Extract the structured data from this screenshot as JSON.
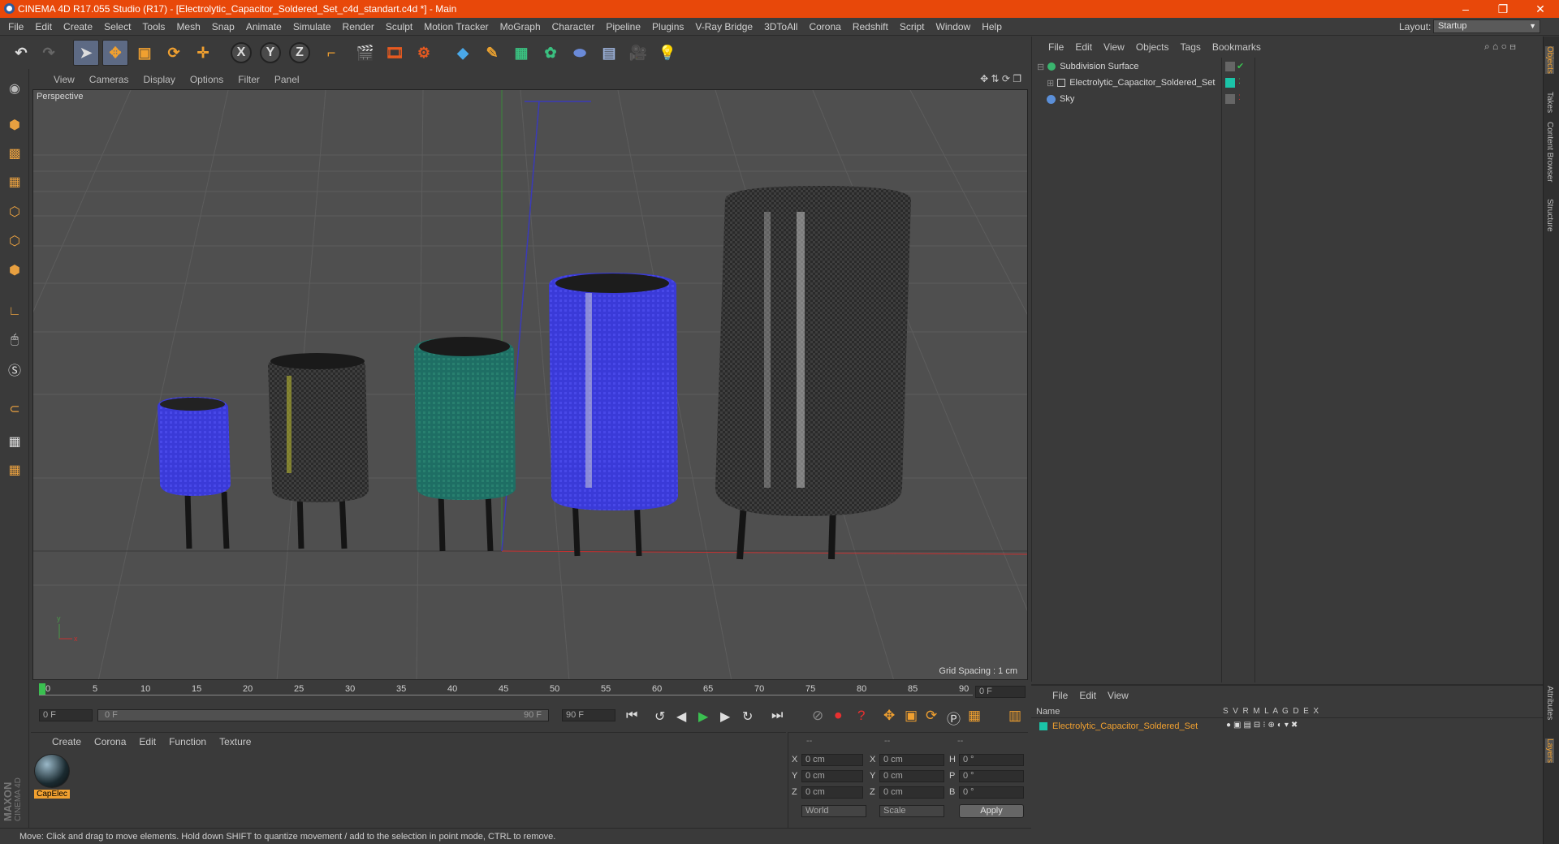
{
  "window": {
    "title": "CINEMA 4D R17.055 Studio (R17) - [Electrolytic_Capacitor_Soldered_Set_c4d_standart.c4d *] - Main",
    "min": "–",
    "restore": "❐",
    "close": "✕"
  },
  "menu": [
    "File",
    "Edit",
    "Create",
    "Select",
    "Tools",
    "Mesh",
    "Snap",
    "Animate",
    "Simulate",
    "Render",
    "Sculpt",
    "Motion Tracker",
    "MoGraph",
    "Character",
    "Pipeline",
    "Plugins",
    "V-Ray Bridge",
    "3DToAll",
    "Corona",
    "Redshift",
    "Script",
    "Window",
    "Help"
  ],
  "layout": {
    "label": "Layout:",
    "value": "Startup"
  },
  "toolbar": {
    "x": "X",
    "y": "Y",
    "z": "Z"
  },
  "viewport": {
    "menu": [
      "View",
      "Cameras",
      "Display",
      "Options",
      "Filter",
      "Panel"
    ],
    "label": "Perspective",
    "grid_spacing": "Grid Spacing : 1 cm"
  },
  "objects": {
    "menu": [
      "File",
      "Edit",
      "View",
      "Objects",
      "Tags",
      "Bookmarks"
    ],
    "items": [
      {
        "name": "Subdivision Surface",
        "color": "#3ab56e"
      },
      {
        "name": "Electrolytic_Capacitor_Soldered_Set",
        "color": "#1bc4a8"
      },
      {
        "name": "Sky",
        "color": "#5b8fd8"
      }
    ]
  },
  "side_tabs": [
    "Objects",
    "Takes",
    "Content Browser",
    "Structure"
  ],
  "side_tabs_bottom": [
    "Attributes",
    "Layers"
  ],
  "timeline": {
    "ticks": [
      "0",
      "5",
      "10",
      "15",
      "20",
      "25",
      "30",
      "35",
      "40",
      "45",
      "50",
      "55",
      "60",
      "65",
      "70",
      "75",
      "80",
      "85",
      "90"
    ],
    "current_frame": "0 F",
    "start": "0 F",
    "range_start": "0 F",
    "range_end": "90 F",
    "end": "90 F"
  },
  "material": {
    "menu": [
      "Create",
      "Corona",
      "Edit",
      "Function",
      "Texture"
    ],
    "name": "CapElec"
  },
  "coords": {
    "headers": [
      "--",
      "--",
      "--"
    ],
    "rows": [
      {
        "a": "X",
        "av": "0 cm",
        "b": "X",
        "bv": "0 cm",
        "c": "H",
        "cv": "0 °"
      },
      {
        "a": "Y",
        "av": "0 cm",
        "b": "Y",
        "bv": "0 cm",
        "c": "P",
        "cv": "0 °"
      },
      {
        "a": "Z",
        "av": "0 cm",
        "b": "Z",
        "bv": "0 cm",
        "c": "B",
        "cv": "0 °"
      }
    ],
    "mode": "World",
    "scale": "Scale",
    "apply": "Apply"
  },
  "layers": {
    "menu": [
      "File",
      "Edit",
      "View"
    ],
    "headers": {
      "name": "Name",
      "cols": "S  V  R  M  L  A  G  D  E  X"
    },
    "item": "Electrolytic_Capacitor_Soldered_Set",
    "item_color": "#1bc4a8"
  },
  "status": "Move: Click and drag to move elements. Hold down SHIFT to quantize movement / add to the selection in point mode, CTRL to remove.",
  "brand": {
    "maxon": "MAXON",
    "c4d": "CINEMA 4D"
  }
}
